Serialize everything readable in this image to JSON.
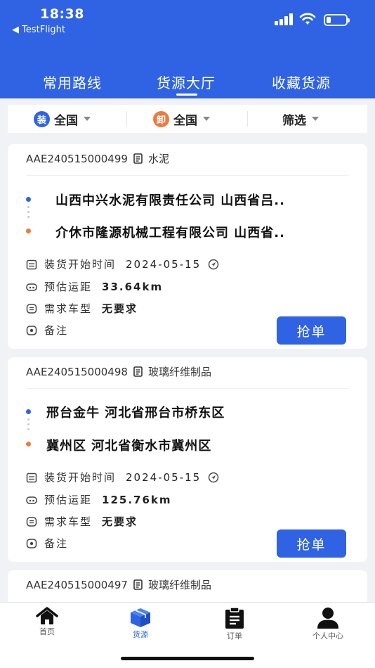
{
  "status_bar": {
    "time": "18:38",
    "back_app": "◀ TestFlight"
  },
  "tabs": [
    {
      "label": "常用路线",
      "active": false
    },
    {
      "label": "货源大厅",
      "active": true
    },
    {
      "label": "收藏货源",
      "active": false
    }
  ],
  "filters": {
    "load": {
      "badge": "装",
      "value": "全国",
      "color": "#2f63e4"
    },
    "unload": {
      "badge": "卸",
      "value": "全国",
      "color": "#ee7a3b"
    },
    "screen": {
      "label": "筛选"
    }
  },
  "labels": {
    "load_time": "装货开始时间",
    "distance": "预估运距",
    "vehicle": "需求车型",
    "remark": "备注",
    "grab": "抢单"
  },
  "cards": [
    {
      "id": "AAE240515000499",
      "goods": "水泥",
      "from": "山西中兴水泥有限责任公司  山西省吕..",
      "to": "介休市隆源机械工程有限公司  山西省..",
      "load_time": "2024-05-15",
      "distance": "33.64km",
      "vehicle": "无要求"
    },
    {
      "id": "AAE240515000498",
      "goods": "玻璃纤维制品",
      "from": "邢台金牛  河北省邢台市桥东区",
      "to": "冀州区  河北省衡水市冀州区",
      "load_time": "2024-05-15",
      "distance": "125.76km",
      "vehicle": "无要求"
    },
    {
      "id": "AAE240515000497",
      "goods": "玻璃纤维制品"
    }
  ],
  "bottom_nav": [
    {
      "label": "首页",
      "icon": "home-icon",
      "active": false
    },
    {
      "label": "货源",
      "icon": "cargo-box-icon",
      "active": true
    },
    {
      "label": "订单",
      "icon": "clipboard-icon",
      "active": false
    },
    {
      "label": "个人中心",
      "icon": "user-icon",
      "active": false
    }
  ],
  "colors": {
    "primary": "#2f63e4",
    "accent_orange": "#ee7a3b",
    "background": "#f1f2f6"
  }
}
